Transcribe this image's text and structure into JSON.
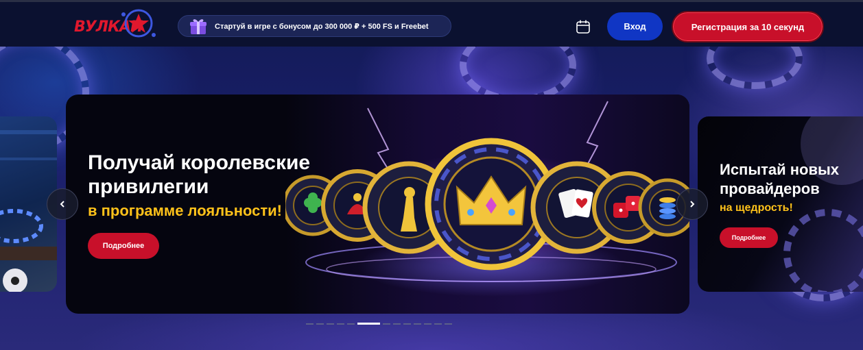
{
  "header": {
    "logo_text": "ВУЛКАН",
    "promo_text": "Стартуй в игре с бонусом до 300 000 ₽ + 500 FS и Freebet",
    "login_label": "Вход",
    "register_label": "Регистрация за 10 секунд"
  },
  "slider": {
    "main": {
      "title": "Получай королевские привилегии",
      "subtitle": "в программе лояльности!",
      "button_label": "Подробнее"
    },
    "next": {
      "title_line1": "Испытай новых",
      "title_line2": "провайдеров",
      "subtitle": "на щедрость!",
      "button_label": "Подробнее"
    },
    "total_slides": 13,
    "active_slide": 5
  },
  "colors": {
    "accent_red": "#c8102a",
    "accent_blue": "#1036c4",
    "highlight_yellow": "#ffc21a",
    "header_bg": "#0b1130"
  },
  "icons": [
    "gift-icon",
    "calendar-icon",
    "chevron-left-icon",
    "chevron-right-icon",
    "crown-icon"
  ]
}
